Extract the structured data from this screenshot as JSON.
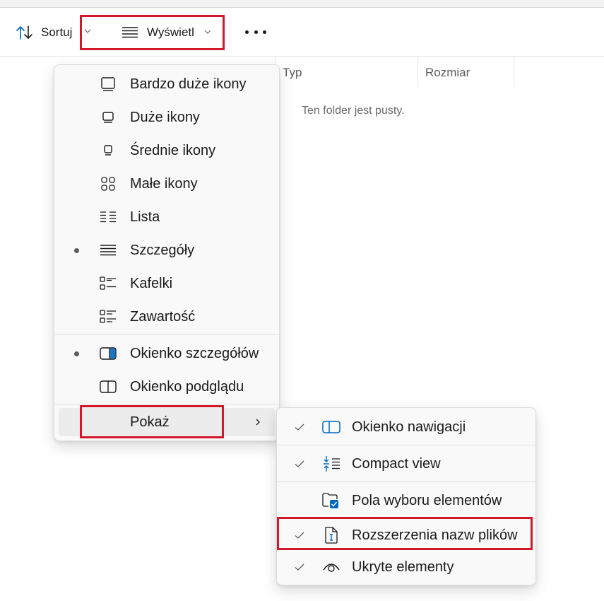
{
  "toolbar": {
    "sort_label": "Sortuj",
    "view_label": "Wyświetl",
    "more_icon": "more-icon",
    "sort_icon": "sort-icon",
    "view_icon": "view-details-icon"
  },
  "columns": {
    "type": "Typ",
    "size": "Rozmiar"
  },
  "empty_message": "Ten folder jest pusty.",
  "view_menu": {
    "layouts": [
      {
        "label": "Bardzo duże ikony",
        "icon": "extra-large-icons-icon",
        "selected": false
      },
      {
        "label": "Duże ikony",
        "icon": "large-icons-icon",
        "selected": false
      },
      {
        "label": "Średnie ikony",
        "icon": "medium-icons-icon",
        "selected": false
      },
      {
        "label": "Małe ikony",
        "icon": "small-icons-icon",
        "selected": false
      },
      {
        "label": "Lista",
        "icon": "list-icon",
        "selected": false
      },
      {
        "label": "Szczegóły",
        "icon": "details-icon",
        "selected": true
      },
      {
        "label": "Kafelki",
        "icon": "tiles-icon",
        "selected": false
      },
      {
        "label": "Zawartość",
        "icon": "content-icon",
        "selected": false
      }
    ],
    "panes": [
      {
        "label": "Okienko szczegółów",
        "icon": "details-pane-icon",
        "selected": true
      },
      {
        "label": "Okienko podglądu",
        "icon": "preview-pane-icon",
        "selected": false
      }
    ],
    "show": {
      "label": "Pokaż",
      "icon": "chevron-right-icon"
    }
  },
  "show_submenu": {
    "items": [
      {
        "label": "Okienko nawigacji",
        "icon": "navigation-pane-icon",
        "checked": true
      },
      {
        "label": "Compact view",
        "icon": "compact-view-icon",
        "checked": true
      },
      {
        "label": "Pola wyboru elementów",
        "icon": "item-checkboxes-icon",
        "checked": false
      },
      {
        "label": "Rozszerzenia nazw plików",
        "icon": "file-extensions-icon",
        "checked": true
      },
      {
        "label": "Ukryte elementy",
        "icon": "hidden-items-icon",
        "checked": true
      }
    ]
  },
  "colors": {
    "highlight": "#d4182c",
    "accent": "#0067c0"
  }
}
